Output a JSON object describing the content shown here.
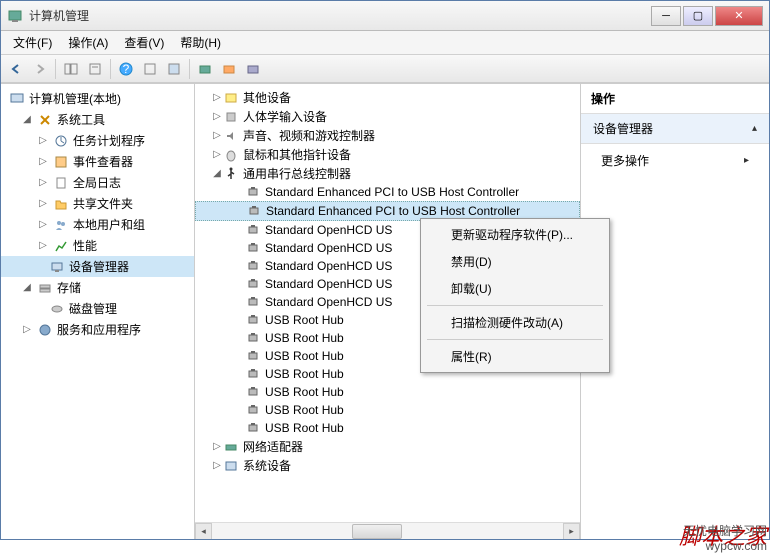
{
  "title": "计算机管理",
  "menubar": [
    "文件(F)",
    "操作(A)",
    "查看(V)",
    "帮助(H)"
  ],
  "left_tree": {
    "root": "计算机管理(本地)",
    "system_tools": "系统工具",
    "system_tools_children": [
      "任务计划程序",
      "事件查看器",
      "共享文件夹",
      "本地用户和组",
      "性能",
      "设备管理器"
    ],
    "global_logs": "全局日志",
    "storage": "存储",
    "storage_children": [
      "磁盘管理"
    ],
    "services": "服务和应用程序"
  },
  "mid_tree": {
    "categories": [
      {
        "label": "其他设备",
        "toggle": "▷"
      },
      {
        "label": "人体学输入设备",
        "toggle": "▷"
      },
      {
        "label": "声音、视频和游戏控制器",
        "toggle": "▷"
      },
      {
        "label": "鼠标和其他指针设备",
        "toggle": "▷"
      }
    ],
    "usb_controller": "通用串行总线控制器",
    "usb_children": [
      "Standard Enhanced PCI to USB Host Controller",
      "Standard Enhanced PCI to USB Host Controller",
      "Standard OpenHCD US",
      "Standard OpenHCD US",
      "Standard OpenHCD US",
      "Standard OpenHCD US",
      "Standard OpenHCD US",
      "USB Root Hub",
      "USB Root Hub",
      "USB Root Hub",
      "USB Root Hub",
      "USB Root Hub",
      "USB Root Hub",
      "USB Root Hub"
    ],
    "after": [
      "网络适配器",
      "系统设备"
    ]
  },
  "context_menu": [
    "更新驱动程序软件(P)...",
    "禁用(D)",
    "卸载(U)",
    "",
    "扫描检测硬件改动(A)",
    "",
    "属性(R)"
  ],
  "right_pane": {
    "header": "操作",
    "section": "设备管理器",
    "action": "更多操作"
  },
  "watermark1": "脚本之家",
  "watermark2_line1": "无忧电脑学习网",
  "watermark2_line2": "wypcw.com"
}
